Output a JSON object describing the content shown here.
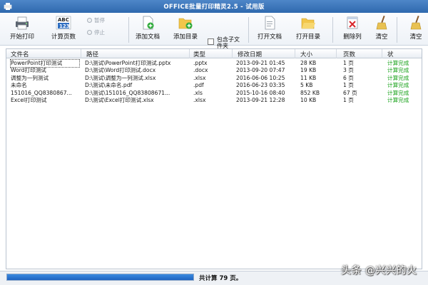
{
  "window": {
    "title": "OFFICE批量打印精灵2.5 - 试用版"
  },
  "toolbar": {
    "start_print": "开始打印",
    "count_pages": "计算页数",
    "abc_badge_top": "ABC",
    "abc_badge_bottom": "123",
    "pause": "暂停",
    "stop": "停止",
    "add_document": "添加文档",
    "add_directory": "添加目录",
    "include_subfolder": "包含子文件夹",
    "open_document": "打开文档",
    "open_directory": "打开目录",
    "delete_column": "删除列",
    "clear_partial": "清空",
    "clear_right": "清空"
  },
  "table": {
    "columns": [
      "文件名",
      "路径",
      "类型",
      "修改日期",
      "大小",
      "页数",
      "状"
    ],
    "rows": [
      {
        "name": "PowerPoint打印测试",
        "path": "D:\\测试\\PowerPoint打印测试.pptx",
        "type": ".pptx",
        "date": "2013-09-21 01:45",
        "size": "28 KB",
        "pages": "1 页",
        "status": "计算完成"
      },
      {
        "name": "Word打印测试",
        "path": "D:\\测试\\Word打印测试.docx",
        "type": ".docx",
        "date": "2013-09-20 07:47",
        "size": "19 KB",
        "pages": "3 页",
        "status": "计算完成"
      },
      {
        "name": "调整为一列测试",
        "path": "D:\\测试\\调整为一列测试.xlsx",
        "type": ".xlsx",
        "date": "2016-06-06 10:25",
        "size": "11 KB",
        "pages": "6 页",
        "status": "计算完成"
      },
      {
        "name": "未命名",
        "path": "D:\\测试\\未命名.pdf",
        "type": ".pdf",
        "date": "2016-06-23 03:35",
        "size": "5 KB",
        "pages": "1 页",
        "status": "计算完成"
      },
      {
        "name": "151016_QQ8380867...",
        "path": "D:\\测试\\151016_QQ83808671...",
        "type": ".xls",
        "date": "2015-10-16 08:40",
        "size": "852 KB",
        "pages": "67 页",
        "status": "计算完成"
      },
      {
        "name": "Excel打印测试",
        "path": "D:\\测试\\Excel打印测试.xlsx",
        "type": ".xlsx",
        "date": "2013-09-21 12:28",
        "size": "10 KB",
        "pages": "1 页",
        "status": "计算完成"
      }
    ]
  },
  "status": {
    "progress_percent": 100,
    "total_text": "共计算 79 页。"
  },
  "watermark": "头条 @兴兴的火",
  "colors": {
    "status_green": "#18a21a",
    "progress_blue": "#1e63c0",
    "title_blue": "#2f69ae"
  }
}
